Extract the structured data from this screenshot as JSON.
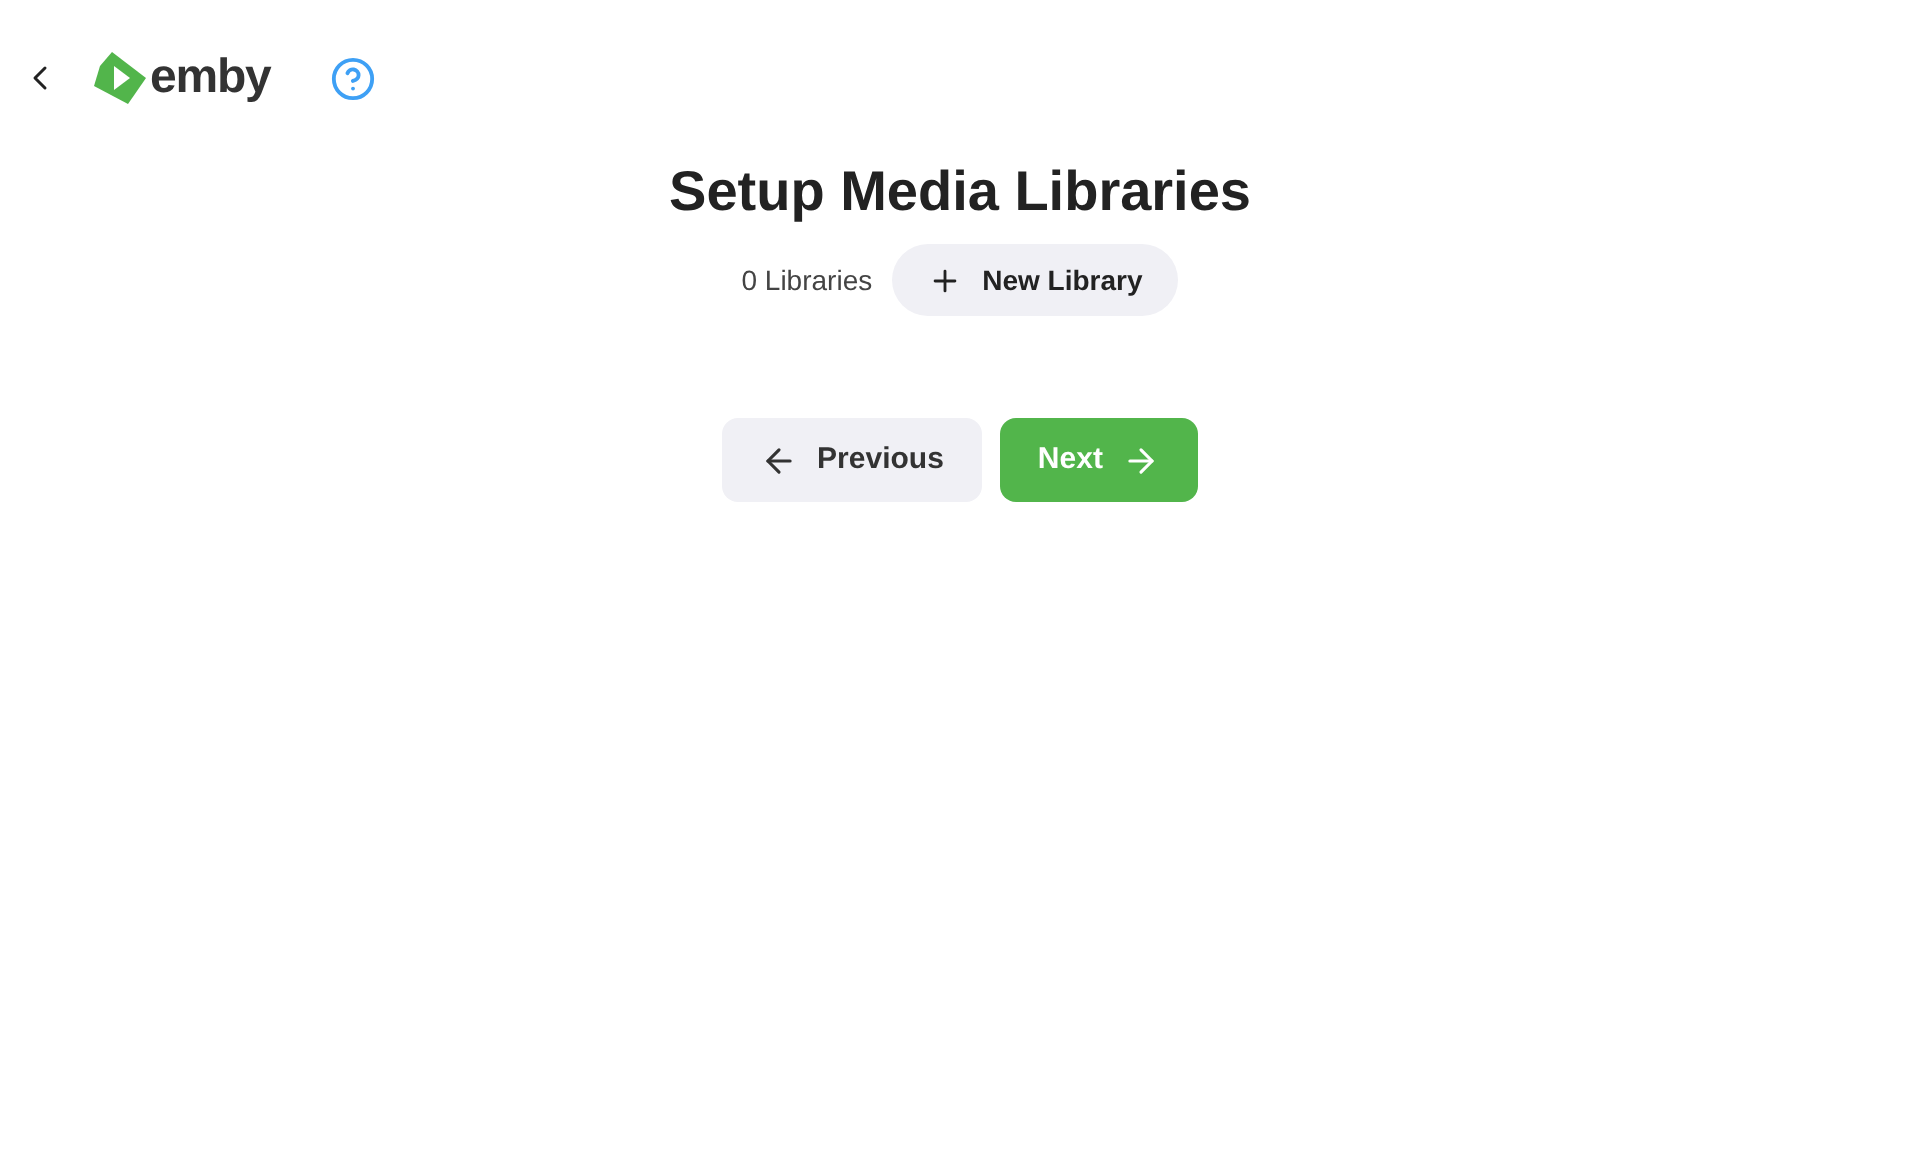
{
  "header": {
    "logo_text": "emby"
  },
  "title": "Setup Media Libraries",
  "library_count": "0 Libraries",
  "new_library_button": {
    "label": "New Library"
  },
  "nav_buttons": [
    {
      "label": "Previous",
      "kind": "secondary"
    },
    {
      "label": "Next",
      "kind": "primary"
    }
  ]
}
